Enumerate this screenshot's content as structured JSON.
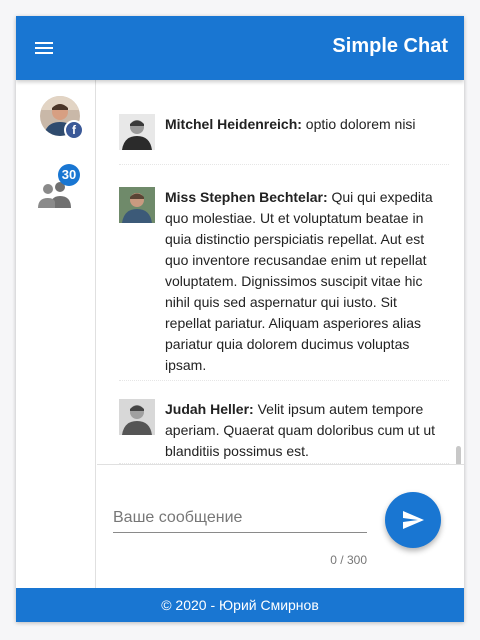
{
  "header": {
    "title": "Simple Chat",
    "menu_icon": "menu-icon"
  },
  "sidebar": {
    "profile_icon": "facebook-icon",
    "users_icon": "people-icon",
    "users_count": "30"
  },
  "messages": [
    {
      "author": "Mitchel Heidenreich:",
      "text": " optio dolorem nisi"
    },
    {
      "author": "Miss Stephen Bechtelar:",
      "text": " Qui qui expedita quo molestiae. Ut et voluptatum beatae in quia distinctio perspiciatis repellat. Aut est quo inventore recusandae enim ut repellat voluptatem. Dignissimos suscipit vitae hic nihil quis sed aspernatur qui iusto. Sit repellat pariatur. Aliquam asperiores alias pariatur quia dolorem ducimus voluptas ipsam."
    },
    {
      "author": "Judah Heller:",
      "text": " Velit ipsum autem tempore aperiam. Quaerat quam doloribus cum ut ut blanditiis possimus est."
    }
  ],
  "composer": {
    "placeholder": "Ваше сообщение",
    "value": "",
    "counter": "0 / 300",
    "send_icon": "send-icon"
  },
  "footer": {
    "text": "© 2020 - Юрий Смирнов"
  },
  "colors": {
    "primary": "#1976d2",
    "facebook": "#3b5998"
  }
}
